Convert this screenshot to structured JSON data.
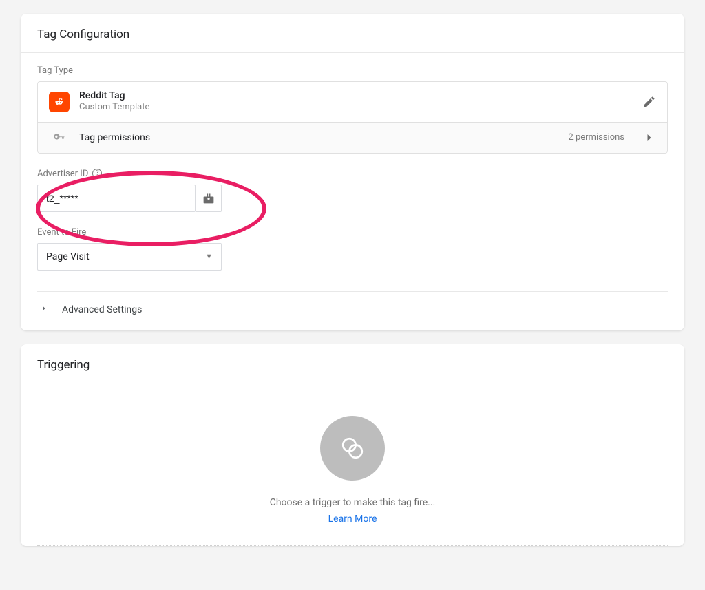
{
  "tagConfig": {
    "title": "Tag Configuration",
    "tagTypeLabel": "Tag Type",
    "tag": {
      "name": "Reddit Tag",
      "subtitle": "Custom Template"
    },
    "permissions": {
      "label": "Tag permissions",
      "count": "2 permissions"
    },
    "advertiserId": {
      "label": "Advertiser ID",
      "value": "t2_*****"
    },
    "eventToFire": {
      "label": "Event to Fire",
      "selected": "Page Visit"
    },
    "advanced": {
      "label": "Advanced Settings"
    }
  },
  "triggering": {
    "title": "Triggering",
    "emptyText": "Choose a trigger to make this tag fire...",
    "learnMore": "Learn More"
  }
}
